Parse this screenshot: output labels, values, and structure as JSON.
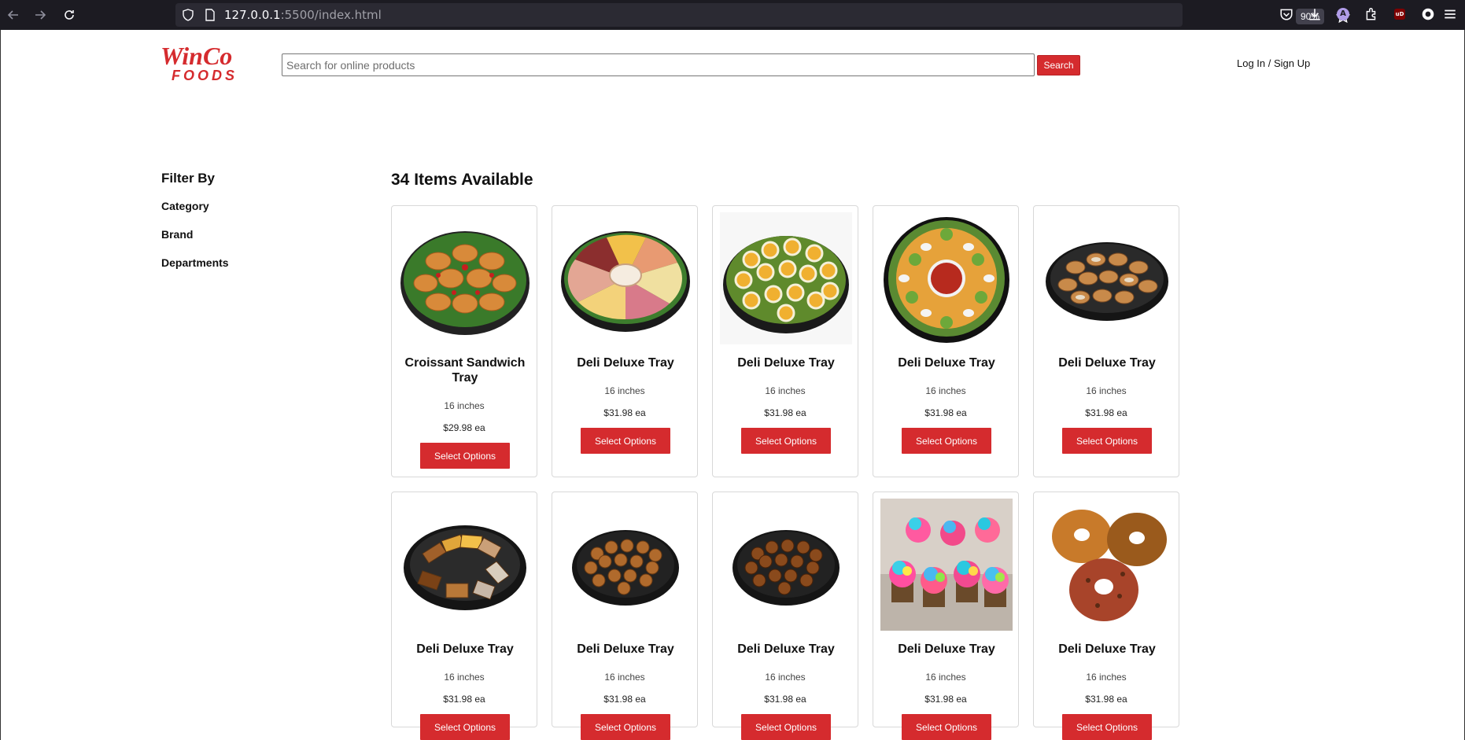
{
  "browser": {
    "url_host": "127.0.0.1",
    "url_rest": ":5500/index.html",
    "zoom": "90%",
    "account_initial": "A",
    "ublock_label": "uD"
  },
  "header": {
    "logo_top": "WinCo",
    "logo_bottom": "FOODS",
    "search_placeholder": "Search for online products",
    "search_label": "Search",
    "login_label": "Log In / Sign Up"
  },
  "sidebar": {
    "title": "Filter By",
    "items": [
      "Category",
      "Brand",
      "Departments"
    ]
  },
  "main": {
    "heading": "34 Items Available",
    "products": [
      {
        "name": "Croissant Sandwich Tray",
        "size": "16 inches",
        "price": "$29.98 ea",
        "button": "Select Options",
        "image": "croissant-tray"
      },
      {
        "name": "Deli Deluxe Tray",
        "size": "16 inches",
        "price": "$31.98 ea",
        "button": "Select Options",
        "image": "deli-meat-cheese-tray"
      },
      {
        "name": "Deli Deluxe Tray",
        "size": "16 inches",
        "price": "$31.98 ea",
        "button": "Select Options",
        "image": "pinwheel-wrap-tray"
      },
      {
        "name": "Deli Deluxe Tray",
        "size": "16 inches",
        "price": "$31.98 ea",
        "button": "Select Options",
        "image": "salsa-salad-tray"
      },
      {
        "name": "Deli Deluxe Tray",
        "size": "16 inches",
        "price": "$31.98 ea",
        "button": "Select Options",
        "image": "pastry-tray"
      },
      {
        "name": "Deli Deluxe Tray",
        "size": "16 inches",
        "price": "$31.98 ea",
        "button": "Select Options",
        "image": "bread-loaf-tray"
      },
      {
        "name": "Deli Deluxe Tray",
        "size": "16 inches",
        "price": "$31.98 ea",
        "button": "Select Options",
        "image": "donut-hole-tray"
      },
      {
        "name": "Deli Deluxe Tray",
        "size": "16 inches",
        "price": "$31.98 ea",
        "button": "Select Options",
        "image": "donut-hole-tray-dark"
      },
      {
        "name": "Deli Deluxe Tray",
        "size": "16 inches",
        "price": "$31.98 ea",
        "button": "Select Options",
        "image": "cupcakes"
      },
      {
        "name": "Deli Deluxe Tray",
        "size": "16 inches",
        "price": "$31.98 ea",
        "button": "Select Options",
        "image": "bagels"
      }
    ]
  },
  "colors": {
    "brand_red": "#d52b2e",
    "chrome_dark": "#1c1b22"
  }
}
